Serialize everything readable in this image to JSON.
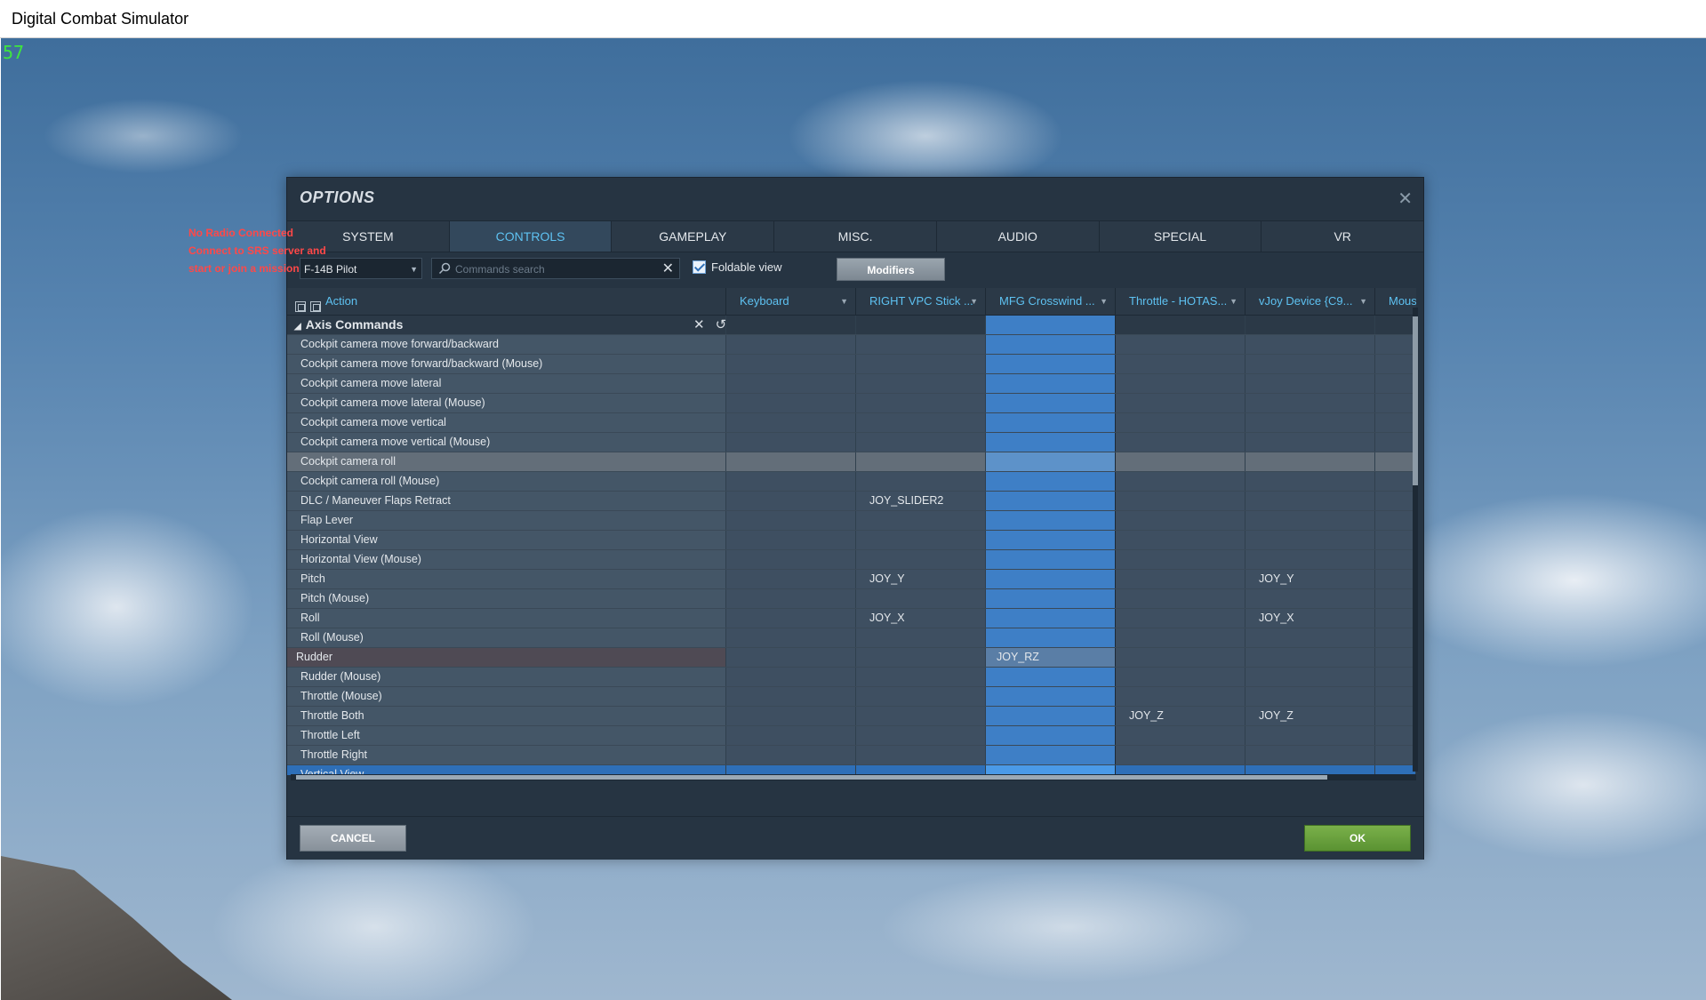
{
  "window": {
    "title": "Digital Combat Simulator"
  },
  "overlay": {
    "fps": "57",
    "srs_lines": [
      "No Radio Connected",
      "Connect to SRS server and",
      "start or join a mission"
    ]
  },
  "dialog": {
    "title": "OPTIONS",
    "tabs": [
      "SYSTEM",
      "CONTROLS",
      "GAMEPLAY",
      "MISC.",
      "AUDIO",
      "SPECIAL",
      "VR"
    ],
    "active_tab": "CONTROLS",
    "aircraft": "F-14B Pilot",
    "search": {
      "value": "",
      "placeholder": "Commands search"
    },
    "foldable_view": {
      "label": "Foldable view",
      "checked": true
    },
    "modifiers_label": "Modifiers",
    "columns": {
      "action": "Action",
      "keyboard": "Keyboard",
      "vpc": "RIGHT VPC Stick ...",
      "mfg": "MFG Crosswind ...",
      "throttle": "Throttle - HOTAS...",
      "vjoy": "vJoy Device {C9...",
      "mouse": "Mous"
    },
    "category": "Axis Commands",
    "rows": [
      {
        "action": "Cockpit camera move forward/backward",
        "vpc": "",
        "mfg": "",
        "throttle": "",
        "vjoy": ""
      },
      {
        "action": "Cockpit camera move forward/backward (Mouse)",
        "vpc": "",
        "mfg": "",
        "throttle": "",
        "vjoy": ""
      },
      {
        "action": "Cockpit camera move lateral",
        "vpc": "",
        "mfg": "",
        "throttle": "",
        "vjoy": ""
      },
      {
        "action": "Cockpit camera move lateral (Mouse)",
        "vpc": "",
        "mfg": "",
        "throttle": "",
        "vjoy": ""
      },
      {
        "action": "Cockpit camera move vertical",
        "vpc": "",
        "mfg": "",
        "throttle": "",
        "vjoy": ""
      },
      {
        "action": "Cockpit camera move vertical (Mouse)",
        "vpc": "",
        "mfg": "",
        "throttle": "",
        "vjoy": ""
      },
      {
        "action": "Cockpit camera roll",
        "vpc": "",
        "mfg": "",
        "throttle": "",
        "vjoy": ""
      },
      {
        "action": "Cockpit camera roll (Mouse)",
        "vpc": "",
        "mfg": "",
        "throttle": "",
        "vjoy": ""
      },
      {
        "action": "DLC / Maneuver Flaps Retract",
        "vpc": "JOY_SLIDER2",
        "mfg": "",
        "throttle": "",
        "vjoy": ""
      },
      {
        "action": "Flap Lever",
        "vpc": "",
        "mfg": "",
        "throttle": "",
        "vjoy": ""
      },
      {
        "action": "Horizontal View",
        "vpc": "",
        "mfg": "",
        "throttle": "",
        "vjoy": ""
      },
      {
        "action": "Horizontal View (Mouse)",
        "vpc": "",
        "mfg": "",
        "throttle": "",
        "vjoy": ""
      },
      {
        "action": "Pitch",
        "vpc": "JOY_Y",
        "mfg": "",
        "throttle": "",
        "vjoy": "JOY_Y"
      },
      {
        "action": "Pitch (Mouse)",
        "vpc": "",
        "mfg": "",
        "throttle": "",
        "vjoy": ""
      },
      {
        "action": "Roll",
        "vpc": "JOY_X",
        "mfg": "",
        "throttle": "",
        "vjoy": "JOY_X"
      },
      {
        "action": "Roll (Mouse)",
        "vpc": "",
        "mfg": "",
        "throttle": "",
        "vjoy": ""
      },
      {
        "action": "Rudder",
        "vpc": "",
        "mfg": "JOY_RZ",
        "throttle": "",
        "vjoy": ""
      },
      {
        "action": "Rudder (Mouse)",
        "vpc": "",
        "mfg": "",
        "throttle": "",
        "vjoy": ""
      },
      {
        "action": "Throttle (Mouse)",
        "vpc": "",
        "mfg": "",
        "throttle": "",
        "vjoy": ""
      },
      {
        "action": "Throttle Both",
        "vpc": "",
        "mfg": "",
        "throttle": "JOY_Z",
        "vjoy": "JOY_Z"
      },
      {
        "action": "Throttle Left",
        "vpc": "",
        "mfg": "",
        "throttle": "",
        "vjoy": ""
      },
      {
        "action": "Throttle Right",
        "vpc": "",
        "mfg": "",
        "throttle": "",
        "vjoy": ""
      },
      {
        "action": "Vertical View",
        "vpc": "",
        "mfg": "",
        "throttle": "",
        "vjoy": ""
      }
    ],
    "cancel_label": "CANCEL",
    "ok_label": "OK"
  }
}
